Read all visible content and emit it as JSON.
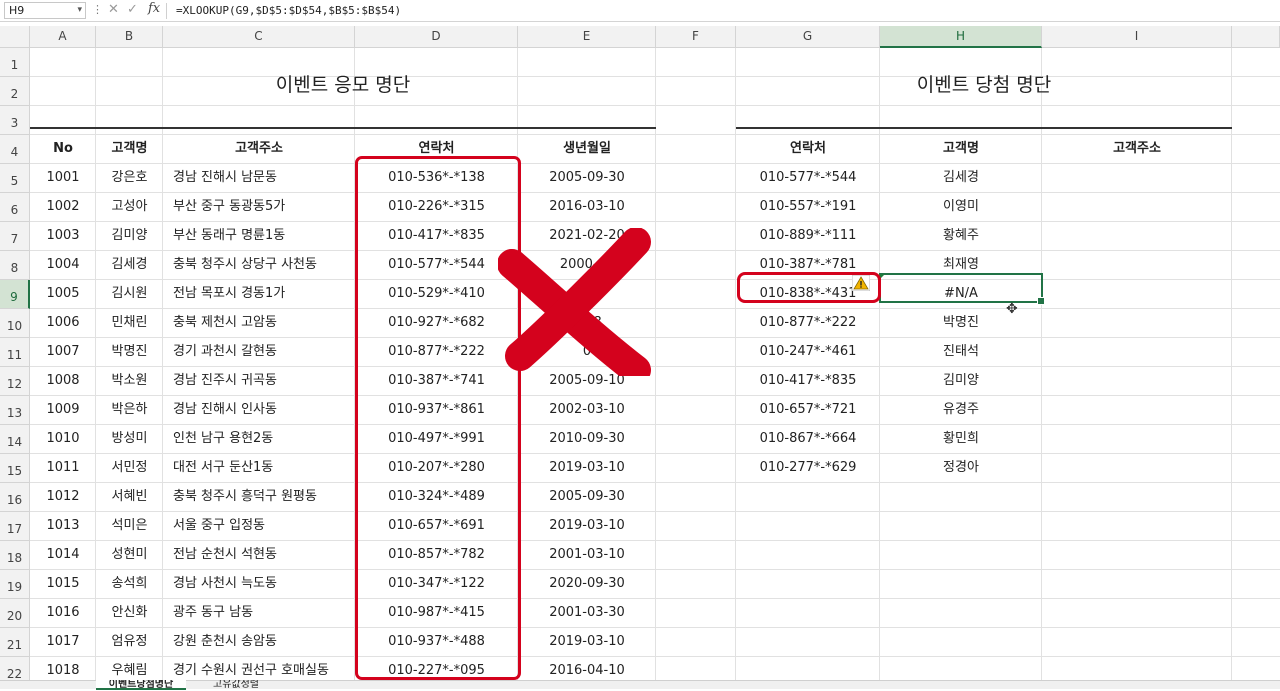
{
  "formula_bar": {
    "name_box": "H9",
    "formula": "=XLOOKUP(G9,$D$5:$D$54,$B$5:$B$54)",
    "fx_label": "fx"
  },
  "columns": [
    "A",
    "B",
    "C",
    "D",
    "E",
    "F",
    "G",
    "H",
    "I"
  ],
  "rows": [
    "1",
    "2",
    "3",
    "4",
    "5",
    "6",
    "7",
    "8",
    "9",
    "10",
    "11",
    "12",
    "13",
    "14",
    "15",
    "16",
    "17",
    "18",
    "19",
    "20",
    "21",
    "22"
  ],
  "left_table": {
    "title": "이벤트 응모 명단",
    "headers": [
      "No",
      "고객명",
      "고객주소",
      "연락처",
      "생년월일"
    ],
    "rows": [
      [
        "1001",
        "강은호",
        "경남 진해시 남문동",
        "010-536*-*138",
        "2005-09-30"
      ],
      [
        "1002",
        "고성아",
        "부산 중구 동광동5가",
        "010-226*-*315",
        "2016-03-10"
      ],
      [
        "1003",
        "김미양",
        "부산 동래구 명륜1동",
        "010-417*-*835",
        "2021-02-20"
      ],
      [
        "1004",
        "김세경",
        "충북 청주시 상당구 사천동",
        "010-577*-*544",
        "2000-03"
      ],
      [
        "1005",
        "김시원",
        "전남 목포시 경동1가",
        "010-529*-*410",
        "20"
      ],
      [
        "1006",
        "민채린",
        "충북 제천시 고암동",
        "010-927*-*682",
        "2-28"
      ],
      [
        "1007",
        "박명진",
        "경기 과천시 갈현동",
        "010-877*-*222",
        "0"
      ],
      [
        "1008",
        "박소원",
        "경남 진주시 귀곡동",
        "010-387*-*741",
        "2005-09-10"
      ],
      [
        "1009",
        "박은하",
        "경남 진해시 인사동",
        "010-937*-*861",
        "2002-03-10"
      ],
      [
        "1010",
        "방성미",
        "인천 남구 용현2동",
        "010-497*-*991",
        "2010-09-30"
      ],
      [
        "1011",
        "서민정",
        "대전 서구 둔산1동",
        "010-207*-*280",
        "2019-03-10"
      ],
      [
        "1012",
        "서혜빈",
        "충북 청주시 흥덕구 원평동",
        "010-324*-*489",
        "2005-09-30"
      ],
      [
        "1013",
        "석미은",
        "서울 중구 입정동",
        "010-657*-*691",
        "2019-03-10"
      ],
      [
        "1014",
        "성현미",
        "전남 순천시 석현동",
        "010-857*-*782",
        "2001-03-10"
      ],
      [
        "1015",
        "송석희",
        "경남 사천시 늑도동",
        "010-347*-*122",
        "2020-09-30"
      ],
      [
        "1016",
        "안신화",
        "광주 동구 남동",
        "010-987*-*415",
        "2001-03-30"
      ],
      [
        "1017",
        "엄유정",
        "강원 춘천시 송암동",
        "010-937*-*488",
        "2019-03-10"
      ],
      [
        "1018",
        "우혜림",
        "경기 수원시 권선구 호매실동",
        "010-227*-*095",
        "2016-04-10"
      ]
    ]
  },
  "right_table": {
    "title": "이벤트 당첨 명단",
    "headers": [
      "연락처",
      "고객명",
      "고객주소"
    ],
    "rows": [
      [
        "010-577*-*544",
        "김세경",
        ""
      ],
      [
        "010-557*-*191",
        "이영미",
        ""
      ],
      [
        "010-889*-*111",
        "황혜주",
        ""
      ],
      [
        "010-387*-*781",
        "최재영",
        ""
      ],
      [
        "010-838*-*431",
        "#N/A",
        ""
      ],
      [
        "010-877*-*222",
        "박명진",
        ""
      ],
      [
        "010-247*-*461",
        "진태석",
        ""
      ],
      [
        "010-417*-*835",
        "김미양",
        ""
      ],
      [
        "010-657*-*721",
        "유경주",
        ""
      ],
      [
        "010-867*-*664",
        "황민희",
        ""
      ],
      [
        "010-277*-*629",
        "정경아",
        ""
      ]
    ]
  },
  "sheet_tabs": [
    "이벤트당첨명단",
    "고유값정렬"
  ],
  "colors": {
    "accent": "#217346",
    "red_mark": "#d4021d"
  },
  "icons": [
    "chevron-down-icon",
    "cancel-icon",
    "enter-icon",
    "warning-icon",
    "cross-mark-icon",
    "cell-cursor-icon"
  ]
}
